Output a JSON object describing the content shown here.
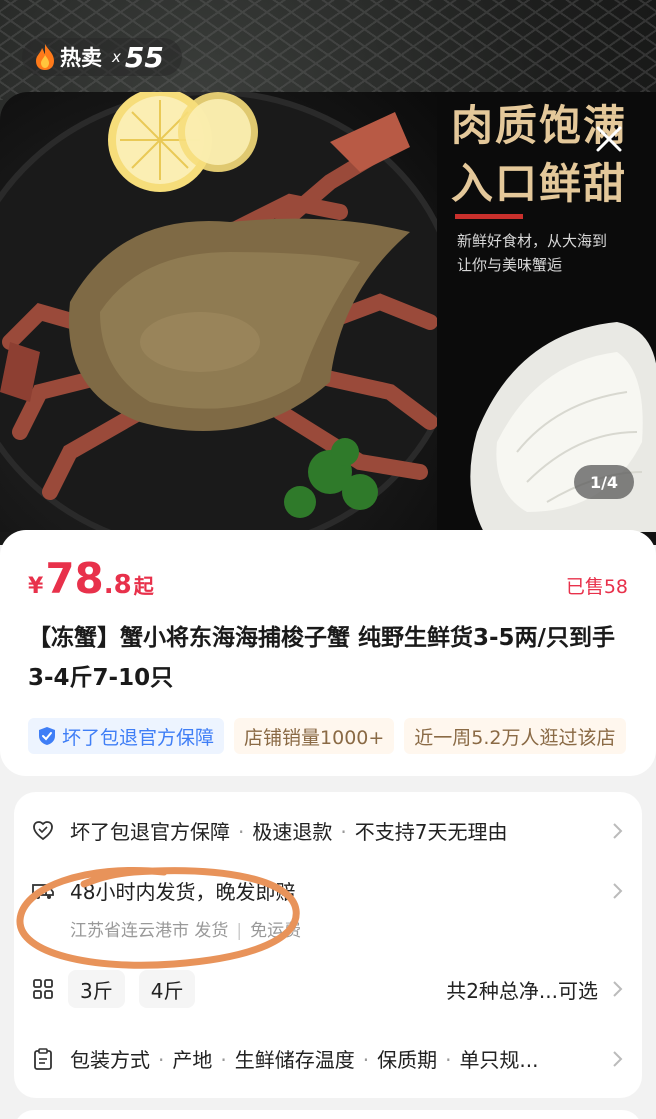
{
  "hero": {
    "hot_label": "热卖",
    "hot_multiplier": "x",
    "hot_count": "55",
    "pager": "1/4",
    "poster": {
      "title_line1": "肉质饱满",
      "title_line2": "入口鲜甜",
      "sub_line1": "新鲜好食材，从大海到",
      "sub_line2": "让你与美味蟹逅"
    }
  },
  "product": {
    "currency": "¥",
    "price_int": "78",
    "price_dec": ".8",
    "price_suffix": "起",
    "sold": "已售58",
    "title": "【冻蟹】蟹小将东海海捕梭子蟹 纯野生鲜货3-5两/只到手3-4斤7-10只",
    "tags": [
      {
        "label": "坏了包退官方保障",
        "style": "blue",
        "icon": "shield-check-icon"
      },
      {
        "label": "店铺销量1000+",
        "style": "warm"
      },
      {
        "label": "近一周5.2万人逛过该店",
        "style": "warm"
      }
    ]
  },
  "service": {
    "guarantee": {
      "items": [
        "坏了包退官方保障",
        "极速退款",
        "不支持7天无理由"
      ]
    },
    "shipping": {
      "title": "48小时内发货，晚发即赔",
      "origin": "江苏省连云港市 发货",
      "fee": "免运费"
    },
    "specs": {
      "options": [
        "3斤",
        "4斤"
      ],
      "summary": "共2种总净...可选"
    },
    "params": {
      "items": [
        "包装方式",
        "产地",
        "生鲜储存温度",
        "保质期",
        "单只规..."
      ]
    }
  },
  "colors": {
    "price_red": "#e8314b",
    "tag_blue": "#3f7ef6",
    "annotation_orange": "#e8935a"
  }
}
